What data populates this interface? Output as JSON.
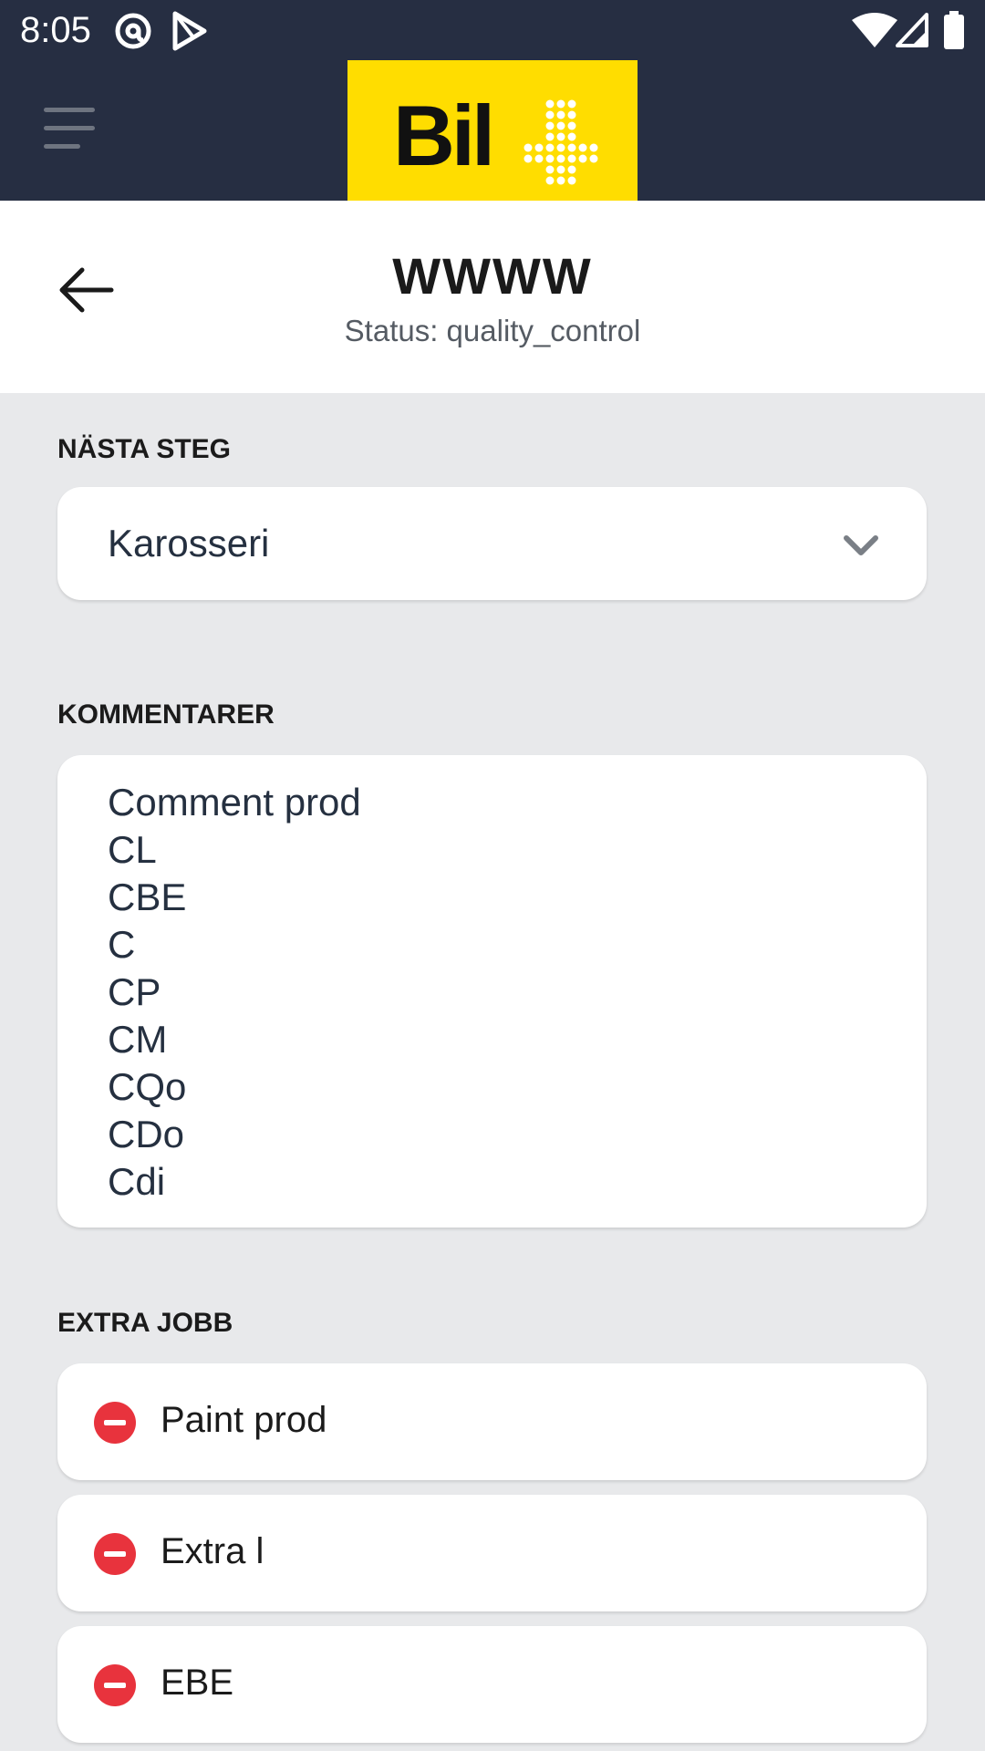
{
  "status_bar": {
    "time": "8:05",
    "left_icons": [
      "at-sign-icon",
      "play-store-icon"
    ],
    "right_icons": [
      "wifi-icon",
      "signal-icon",
      "battery-icon"
    ]
  },
  "app_bar": {
    "logo_text": "Bil",
    "menu_icon": "hamburger-menu-icon",
    "colors": {
      "background": "#262e42",
      "logo_bg": "#ffdd00"
    }
  },
  "header": {
    "title": "WWWW",
    "status": "Status: quality_control",
    "back_icon": "arrow-left-icon"
  },
  "next_step": {
    "label": "NÄSTA STEG",
    "selected": "Karosseri"
  },
  "comments": {
    "label": "KOMMENTARER",
    "lines": [
      "Comment prod",
      "CL",
      "CBE",
      "C",
      "CP",
      "CM",
      "CQo",
      "CDo",
      "Cdi"
    ]
  },
  "extra_jobs": {
    "label": "EXTRA JOBB",
    "items": [
      {
        "label": "Paint prod",
        "icon": "remove-icon"
      },
      {
        "label": "Extra l",
        "icon": "remove-icon"
      },
      {
        "label": "EBE",
        "icon": "remove-icon"
      }
    ],
    "colors": {
      "remove": "#e8333d"
    }
  }
}
